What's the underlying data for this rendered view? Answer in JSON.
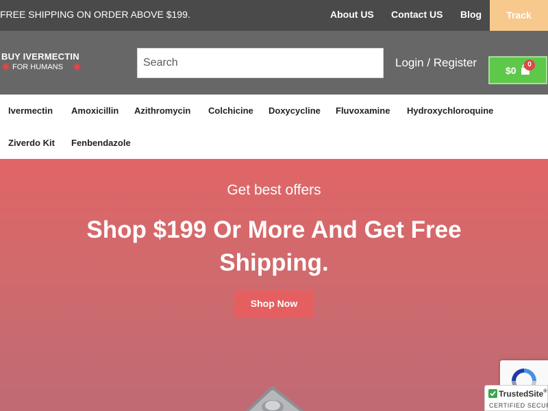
{
  "topbar": {
    "promo": "FREE SHIPPING ON ORDER ABOVE $199.",
    "links": [
      "About US",
      "Contact US",
      "Blog"
    ],
    "track": "Track"
  },
  "header": {
    "logo_line1": "BUY IVERMECTIN",
    "logo_line2": "FOR HUMANS",
    "search_placeholder": "Search",
    "login_register": "Login / Register",
    "cart_amount": "$0",
    "cart_count": "0"
  },
  "nav": {
    "items": [
      "Ivermectin",
      "Amoxicillin",
      "Azithromycin",
      "Colchicine",
      "Doxycycline",
      "Fluvoxamine",
      "Hydroxychloroquine",
      "Ziverdo Kit",
      "Fenbendazole"
    ]
  },
  "hero": {
    "eyebrow": "Get best offers",
    "headline": "Shop $199 Or More And Get Free Shipping.",
    "button": "Shop Now"
  },
  "widgets": {
    "trusted_name": "TrustedSite",
    "trusted_mark": "®",
    "trusted_sub": "CERTIFIED SECURE"
  },
  "colors": {
    "topbar": "#4a4a4a",
    "header": "#676767",
    "track": "#f7c98d",
    "cart": "#5dc84a",
    "hero": "#e06566",
    "shop_button": "#e55f60"
  }
}
